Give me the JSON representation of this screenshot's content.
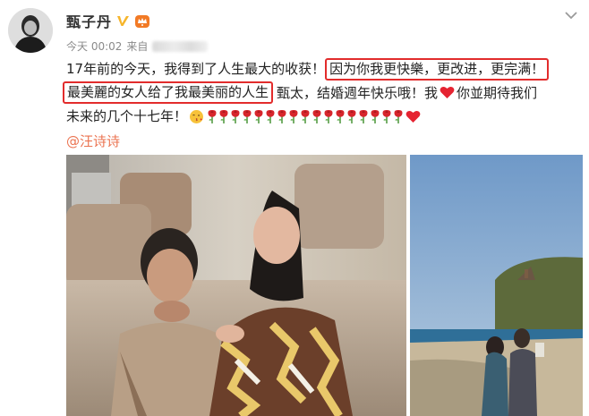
{
  "post": {
    "author": "甄子丹",
    "time": "今天 00:02",
    "source_prefix": "来自",
    "text_lines": [
      [
        "17年前的今天，我得到了人生最大的收获！",
        "因为你我更快樂，更改进，更完满！"
      ],
      [
        "最美麗的女人给了我最美丽的人生",
        "甄太，结婚週年快乐哦！我",
        "你並期待我们"
      ],
      [
        "未来的几个十七年！"
      ]
    ],
    "mention": "@汪诗诗"
  },
  "colors": {
    "accent_orange": "#eb7350",
    "highlight_red": "#e22c2c",
    "verified_gold": "#f6b52b"
  },
  "icons": {
    "verified": "verified-v-icon",
    "member": "vip-crown-icon",
    "menu": "chevron-down-icon",
    "emoji": [
      "kiss-emoji",
      "rose-emoji",
      "heart-emoji"
    ]
  }
}
